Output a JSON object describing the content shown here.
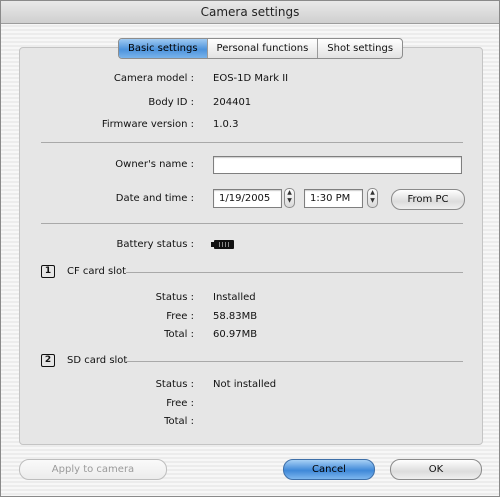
{
  "window": {
    "title": "Camera settings"
  },
  "tabs": [
    {
      "label": "Basic settings",
      "active": true
    },
    {
      "label": "Personal functions",
      "active": false
    },
    {
      "label": "Shot settings",
      "active": false
    }
  ],
  "camera": {
    "model_label": "Camera model :",
    "model_value": "EOS-1D Mark II",
    "body_id_label": "Body ID :",
    "body_id_value": "204401",
    "firmware_label": "Firmware version :",
    "firmware_value": "1.0.3"
  },
  "owner": {
    "label": "Owner's name :",
    "value": ""
  },
  "datetime": {
    "label": "Date and time :",
    "date_value": "1/19/2005",
    "time_value": "1:30 PM",
    "from_pc_label": "From PC"
  },
  "battery": {
    "label": "Battery status :",
    "icon": "battery-full-icon"
  },
  "cf_slot": {
    "icon_text": "1",
    "title": "CF card slot",
    "status_label": "Status :",
    "status_value": "Installed",
    "free_label": "Free :",
    "free_value": "58.83MB",
    "total_label": "Total :",
    "total_value": "60.97MB"
  },
  "sd_slot": {
    "icon_text": "2",
    "title": "SD card slot",
    "status_label": "Status :",
    "status_value": "Not installed",
    "free_label": "Free :",
    "free_value": "",
    "total_label": "Total :",
    "total_value": ""
  },
  "buttons": {
    "apply": "Apply to camera",
    "cancel": "Cancel",
    "ok": "OK"
  },
  "colors": {
    "accent": "#4d93dc",
    "default_button": "#3f88d8"
  }
}
